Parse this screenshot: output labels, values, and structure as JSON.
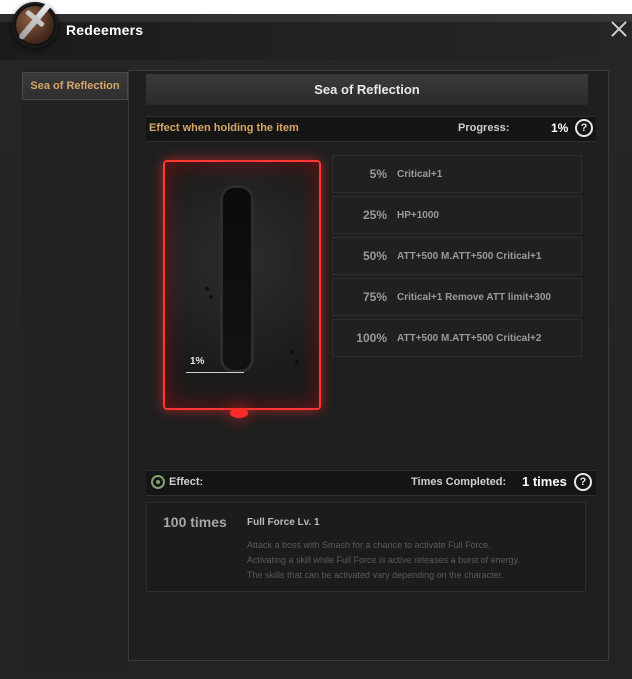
{
  "window": {
    "title": "Redeemers"
  },
  "sidebar": {
    "active_tab": "Sea of Reflection"
  },
  "panel": {
    "title": "Sea of Reflection",
    "holding_effect_label": "Effect when holding the item",
    "progress_label": "Progress:",
    "progress_value": "1%",
    "item_progress_marker": "1%"
  },
  "milestones": [
    {
      "percent": "5%",
      "effect": "Critical+1"
    },
    {
      "percent": "25%",
      "effect": "HP+1000"
    },
    {
      "percent": "50%",
      "effect": "ATT+500  M.ATT+500  Critical+1"
    },
    {
      "percent": "75%",
      "effect": "Critical+1  Remove ATT limit+300"
    },
    {
      "percent": "100%",
      "effect": "ATT+500  M.ATT+500  Critical+2"
    }
  ],
  "effect_section": {
    "label": "Effect:",
    "times_completed_label": "Times Completed:",
    "times_completed_value": "1 times",
    "effect_times": "100 times",
    "effect_name": "Full Force Lv. 1",
    "description_lines": [
      "Attack a boss with Smash for a chance to activate Full Force.",
      "Activating a skill while Full Force is active releases a burst of energy.",
      "The skills that can be activated vary depending on the character."
    ]
  },
  "icons": {
    "logo": "sword-logo-icon",
    "close": "close-icon",
    "help": "help-icon",
    "radio": "radio-icon"
  }
}
